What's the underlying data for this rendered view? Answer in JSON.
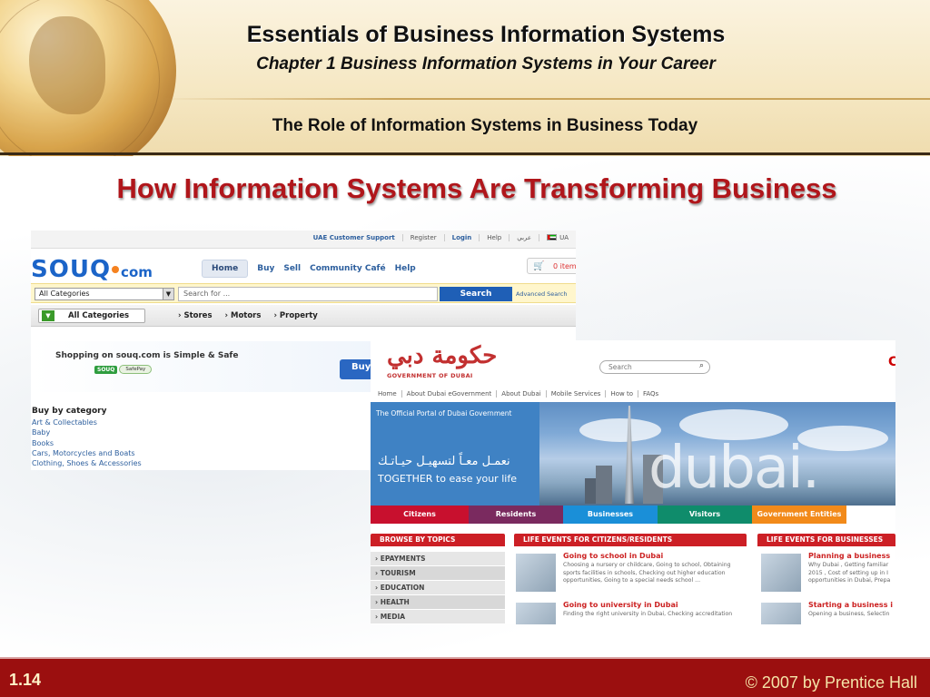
{
  "header": {
    "title": "Essentials of Business Information Systems",
    "subtitle": "Chapter 1 Business Information Systems in Your Career",
    "section": "The Role of Information Systems in Business Today"
  },
  "slide_heading": "How Information Systems Are Transforming Business",
  "souq": {
    "top_links": [
      "UAE Customer Support",
      "Register",
      "Login",
      "Help",
      "عربي",
      "UA"
    ],
    "logo_main": "SOUQ",
    "logo_suffix": "com",
    "nav": [
      "Home",
      "Buy",
      "Sell",
      "Community Café",
      "Help"
    ],
    "cart_count": "0 item",
    "category_select": "All Categories",
    "search_placeholder": "Search for ...",
    "search_button": "Search",
    "advanced_search": "Advanced Search",
    "all_categories_button": "All Categories",
    "cat_links": [
      "Stores",
      "Motors",
      "Property"
    ],
    "banner_text": "Shopping on souq.com is Simple & Safe",
    "safepay_brand": "SOUQ",
    "safepay_label": "SafePay",
    "buy_button": "Buy",
    "buy_by_category_title": "Buy by category",
    "categories": [
      "Art & Collectables",
      "Baby",
      "Books",
      "Cars, Motorcycles and Boats",
      "Clothing, Shoes & Accessories"
    ]
  },
  "dubai": {
    "logo_arabic": "حكومة دبي",
    "logo_english": "GOVERNMENT OF DUBAI",
    "search_placeholder": "Search",
    "corner_letter": "C",
    "nav_links": [
      "Home",
      "About Dubai eGovernment",
      "About Dubai",
      "Mobile Services",
      "How to",
      "FAQs"
    ],
    "portal_text": "The Official Portal of Dubai Government",
    "tagline_arabic": "نعمـل معـاً لتسهيـل حيـاتـك",
    "tagline_english": "TOGETHER to ease your life",
    "hero_word": "dubai.",
    "tabs": [
      {
        "label": "Citizens",
        "color": "#c8102e"
      },
      {
        "label": "Residents",
        "color": "#7a2a5f"
      },
      {
        "label": "Businesses",
        "color": "#1a8fd8"
      },
      {
        "label": "Visitors",
        "color": "#0f8c6b"
      },
      {
        "label": "Government Entities",
        "color": "#f28a1a"
      }
    ],
    "browse_title": "BROWSE BY TOPICS",
    "topics": [
      "EPAYMENTS",
      "TOURISM",
      "EDUCATION",
      "HEALTH",
      "MEDIA"
    ],
    "citizens_title": "LIFE EVENTS FOR CITIZENS/RESIDENTS",
    "citizen_events": [
      {
        "title": "Going to school in Dubai",
        "desc": "Choosing a nursery or childcare, Going to school, Obtaining sports facilities in schools, Checking out higher education opportunities, Going to a special needs school ..."
      },
      {
        "title": "Going to university in Dubai",
        "desc": "Finding the right university in Dubai, Checking accreditation"
      }
    ],
    "business_title": "LIFE EVENTS FOR BUSINESSES",
    "business_events": [
      {
        "title": "Planning a business",
        "desc": "Why Dubai , Getting familiar 2015 , Cost of setting up in I opportunities in Dubai, Prepa"
      },
      {
        "title": "Starting a business i",
        "desc": "Opening a business, Selectin"
      }
    ]
  },
  "footer": {
    "slide_number": "1.14",
    "copyright": "© 2007 by Prentice Hall"
  }
}
